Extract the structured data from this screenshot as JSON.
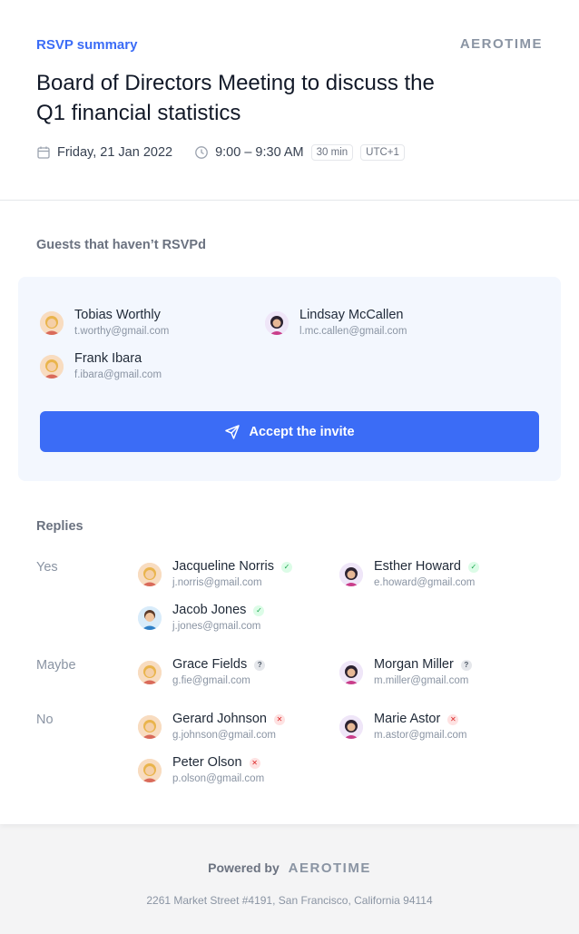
{
  "header": {
    "label": "RSVP summary",
    "logo": "AEROTIME",
    "title": "Board of Directors Meeting to discuss the Q1 financial statistics",
    "date": "Friday, 21 Jan 2022",
    "time": "9:00 – 9:30 AM",
    "duration": "30 min",
    "timezone": "UTC+1"
  },
  "pending": {
    "title": "Guests that haven’t RSVPd",
    "guests": [
      {
        "name": "Tobias Worthly",
        "email": "t.worthy@gmail.com"
      },
      {
        "name": "Lindsay McCallen",
        "email": "l.mc.callen@gmail.com"
      },
      {
        "name": "Frank Ibara",
        "email": "f.ibara@gmail.com"
      }
    ],
    "button_label": "Accept the invite"
  },
  "replies": {
    "title": "Replies",
    "yes": {
      "label": "Yes",
      "people": [
        {
          "name": "Jacqueline Norris",
          "email": "j.norris@gmail.com"
        },
        {
          "name": "Esther Howard",
          "email": "e.howard@gmail.com"
        },
        {
          "name": "Jacob Jones",
          "email": "j.jones@gmail.com"
        }
      ]
    },
    "maybe": {
      "label": "Maybe",
      "people": [
        {
          "name": "Grace Fields",
          "email": "g.fie@gmail.com"
        },
        {
          "name": "Morgan Miller",
          "email": "m.miller@gmail.com"
        }
      ]
    },
    "no": {
      "label": "No",
      "people": [
        {
          "name": "Gerard Johnson",
          "email": "g.johnson@gmail.com"
        },
        {
          "name": "Marie Astor",
          "email": "m.astor@gmail.com"
        },
        {
          "name": "Peter Olson",
          "email": "p.olson@gmail.com"
        }
      ]
    }
  },
  "footer": {
    "powered_by": "Powered by",
    "logo": "AEROTIME",
    "address": "2261 Market Street #4191, San Francisco, California 94114"
  },
  "colors": {
    "accent": "#3b6cf6",
    "pending_bg": "#f3f7fe",
    "yes": "#16a34a",
    "no": "#dc2626"
  }
}
